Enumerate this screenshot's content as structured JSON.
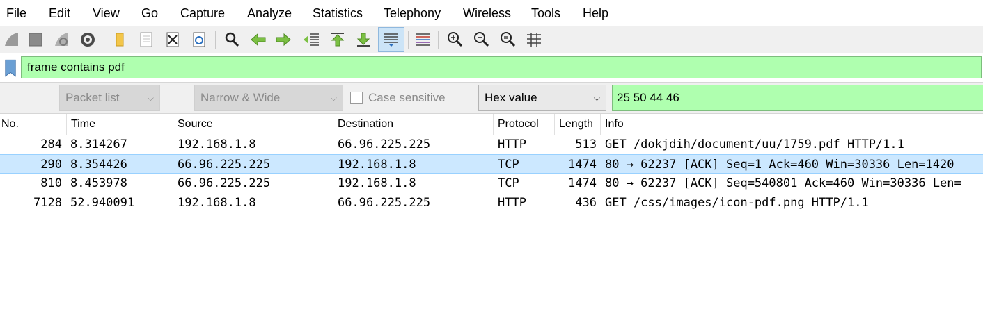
{
  "menu": {
    "items": [
      "File",
      "Edit",
      "View",
      "Go",
      "Capture",
      "Analyze",
      "Statistics",
      "Telephony",
      "Wireless",
      "Tools",
      "Help"
    ]
  },
  "toolbar": {
    "icons": [
      "shark-fin-start-icon",
      "stop-capture-icon",
      "restart-capture-icon",
      "capture-options-gear-icon",
      "open-file-folder-icon",
      "save-file-icon",
      "close-file-icon",
      "reload-file-icon",
      "find-packet-magnifier-icon",
      "go-back-arrow-icon",
      "go-forward-arrow-icon",
      "go-to-packet-icon",
      "go-to-first-packet-icon",
      "go-to-last-packet-icon",
      "auto-scroll-icon",
      "colorize-icon",
      "zoom-in-icon",
      "zoom-out-icon",
      "normal-size-icon",
      "resize-columns-icon"
    ],
    "active_icon": "auto-scroll-icon"
  },
  "filter": {
    "value": "frame contains pdf",
    "background": "#afffaf"
  },
  "find": {
    "search_in": "Packet list",
    "char_width": "Narrow & Wide",
    "case_sensitive_label": "Case sensitive",
    "search_type": "Hex value",
    "search_value": "25 50 44 46"
  },
  "packet_list": {
    "columns": [
      "No.",
      "Time",
      "Source",
      "Destination",
      "Protocol",
      "Length",
      "Info"
    ],
    "rows": [
      {
        "no": "284",
        "time": "8.314267",
        "source": "192.168.1.8",
        "destination": "66.96.225.225",
        "protocol": "HTTP",
        "length": "513",
        "info": "GET /dokjdih/document/uu/1759.pdf HTTP/1.1",
        "selected": false
      },
      {
        "no": "290",
        "time": "8.354426",
        "source": "66.96.225.225",
        "destination": "192.168.1.8",
        "protocol": "TCP",
        "length": "1474",
        "info": "80 → 62237 [ACK] Seq=1 Ack=460 Win=30336 Len=1420",
        "selected": true
      },
      {
        "no": "810",
        "time": "8.453978",
        "source": "66.96.225.225",
        "destination": "192.168.1.8",
        "protocol": "TCP",
        "length": "1474",
        "info": "80 → 62237 [ACK] Seq=540801 Ack=460 Win=30336 Len=",
        "selected": false
      },
      {
        "no": "7128",
        "time": "52.940091",
        "source": "192.168.1.8",
        "destination": "66.96.225.225",
        "protocol": "HTTP",
        "length": "436",
        "info": "GET /css/images/icon-pdf.png HTTP/1.1",
        "selected": false
      }
    ],
    "selected_row_color": "#cce8ff"
  }
}
